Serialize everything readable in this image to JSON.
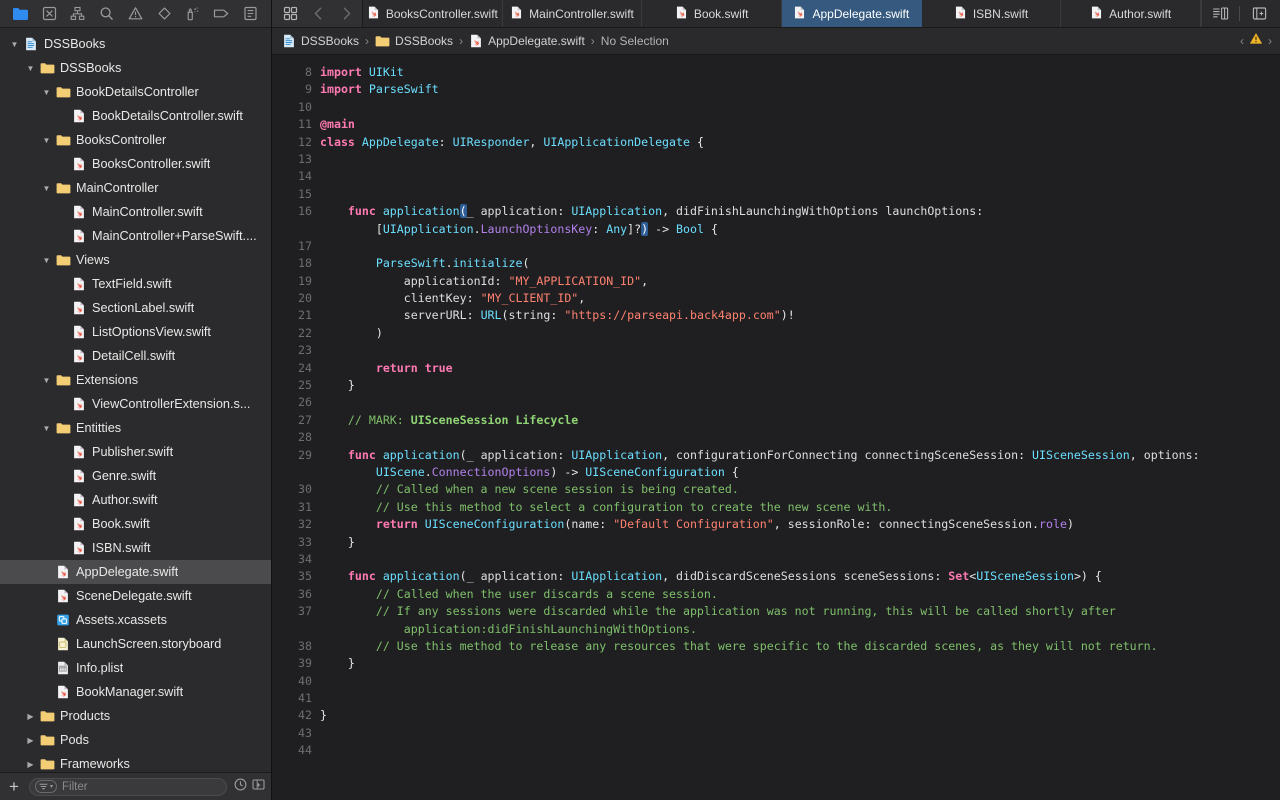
{
  "navigator": {
    "toolbar_icons": [
      {
        "name": "project-navigator-icon",
        "glyph": "folder",
        "active": true
      },
      {
        "name": "source-control-navigator-icon",
        "glyph": "x-box",
        "active": false
      },
      {
        "name": "symbol-navigator-icon",
        "glyph": "hierarchy",
        "active": false
      },
      {
        "name": "find-navigator-icon",
        "glyph": "search",
        "active": false
      },
      {
        "name": "issue-navigator-icon",
        "glyph": "warning-triangle",
        "active": false
      },
      {
        "name": "test-navigator-icon",
        "glyph": "diamond",
        "active": false
      },
      {
        "name": "debug-navigator-icon",
        "glyph": "spray",
        "active": false
      },
      {
        "name": "breakpoint-navigator-icon",
        "glyph": "tag",
        "active": false
      },
      {
        "name": "report-navigator-icon",
        "glyph": "list-box",
        "active": false
      }
    ],
    "tree": [
      {
        "label": "DSSBooks",
        "indent": 0,
        "icon": "project",
        "disclosure": "open",
        "selected": false
      },
      {
        "label": "DSSBooks",
        "indent": 1,
        "icon": "folder",
        "disclosure": "open",
        "selected": false
      },
      {
        "label": "BookDetailsController",
        "indent": 2,
        "icon": "folder",
        "disclosure": "open",
        "selected": false
      },
      {
        "label": "BookDetailsController.swift",
        "indent": 3,
        "icon": "swift",
        "disclosure": "none",
        "selected": false
      },
      {
        "label": "BooksController",
        "indent": 2,
        "icon": "folder",
        "disclosure": "open",
        "selected": false
      },
      {
        "label": "BooksController.swift",
        "indent": 3,
        "icon": "swift",
        "disclosure": "none",
        "selected": false
      },
      {
        "label": "MainController",
        "indent": 2,
        "icon": "folder",
        "disclosure": "open",
        "selected": false
      },
      {
        "label": "MainController.swift",
        "indent": 3,
        "icon": "swift",
        "disclosure": "none",
        "selected": false
      },
      {
        "label": "MainController+ParseSwift....",
        "indent": 3,
        "icon": "swift",
        "disclosure": "none",
        "selected": false
      },
      {
        "label": "Views",
        "indent": 2,
        "icon": "folder",
        "disclosure": "open",
        "selected": false
      },
      {
        "label": "TextField.swift",
        "indent": 3,
        "icon": "swift",
        "disclosure": "none",
        "selected": false
      },
      {
        "label": "SectionLabel.swift",
        "indent": 3,
        "icon": "swift",
        "disclosure": "none",
        "selected": false
      },
      {
        "label": "ListOptionsView.swift",
        "indent": 3,
        "icon": "swift",
        "disclosure": "none",
        "selected": false
      },
      {
        "label": "DetailCell.swift",
        "indent": 3,
        "icon": "swift",
        "disclosure": "none",
        "selected": false
      },
      {
        "label": "Extensions",
        "indent": 2,
        "icon": "folder",
        "disclosure": "open",
        "selected": false
      },
      {
        "label": "ViewControllerExtension.s...",
        "indent": 3,
        "icon": "swift",
        "disclosure": "none",
        "selected": false
      },
      {
        "label": "Entitties",
        "indent": 2,
        "icon": "folder",
        "disclosure": "open",
        "selected": false
      },
      {
        "label": "Publisher.swift",
        "indent": 3,
        "icon": "swift",
        "disclosure": "none",
        "selected": false
      },
      {
        "label": "Genre.swift",
        "indent": 3,
        "icon": "swift",
        "disclosure": "none",
        "selected": false
      },
      {
        "label": "Author.swift",
        "indent": 3,
        "icon": "swift",
        "disclosure": "none",
        "selected": false
      },
      {
        "label": "Book.swift",
        "indent": 3,
        "icon": "swift",
        "disclosure": "none",
        "selected": false
      },
      {
        "label": "ISBN.swift",
        "indent": 3,
        "icon": "swift",
        "disclosure": "none",
        "selected": false
      },
      {
        "label": "AppDelegate.swift",
        "indent": 2,
        "icon": "swift",
        "disclosure": "none",
        "selected": true
      },
      {
        "label": "SceneDelegate.swift",
        "indent": 2,
        "icon": "swift",
        "disclosure": "none",
        "selected": false
      },
      {
        "label": "Assets.xcassets",
        "indent": 2,
        "icon": "assets",
        "disclosure": "none",
        "selected": false
      },
      {
        "label": "LaunchScreen.storyboard",
        "indent": 2,
        "icon": "storyboard",
        "disclosure": "none",
        "selected": false
      },
      {
        "label": "Info.plist",
        "indent": 2,
        "icon": "plist",
        "disclosure": "none",
        "selected": false
      },
      {
        "label": "BookManager.swift",
        "indent": 2,
        "icon": "swift",
        "disclosure": "none",
        "selected": false
      },
      {
        "label": "Products",
        "indent": 1,
        "icon": "folder",
        "disclosure": "closed",
        "selected": false
      },
      {
        "label": "Pods",
        "indent": 1,
        "icon": "folder",
        "disclosure": "closed",
        "selected": false
      },
      {
        "label": "Frameworks",
        "indent": 1,
        "icon": "folder",
        "disclosure": "closed",
        "selected": false
      }
    ],
    "filter": {
      "placeholder": "Filter",
      "add_label": "+",
      "scope_icon": "filter-scope-icon",
      "recent_icon": "clock-icon",
      "nesting_icon": "hierarchy-toggle-icon"
    }
  },
  "tabbar": {
    "left_icons": [
      {
        "name": "editor-options-icon",
        "glyph": "grid"
      },
      {
        "name": "navigate-back-button",
        "glyph": "chevron-left"
      },
      {
        "name": "navigate-forward-button",
        "glyph": "chevron-right"
      }
    ],
    "tabs": [
      {
        "label": "BooksController.swift",
        "active": false
      },
      {
        "label": "MainController.swift",
        "active": false
      },
      {
        "label": "Book.swift",
        "active": false
      },
      {
        "label": "AppDelegate.swift",
        "active": true
      },
      {
        "label": "ISBN.swift",
        "active": false
      },
      {
        "label": "Author.swift",
        "active": false
      }
    ],
    "right_icons": [
      {
        "name": "minimap-toggle-icon",
        "glyph": "minimap"
      },
      {
        "name": "add-editor-icon",
        "glyph": "add-pane"
      }
    ]
  },
  "jumpbar": {
    "crumbs": [
      {
        "label": "DSSBooks",
        "icon": "project"
      },
      {
        "label": "DSSBooks",
        "icon": "folder"
      },
      {
        "label": "AppDelegate.swift",
        "icon": "swift"
      },
      {
        "label": "No Selection",
        "icon": "none"
      }
    ],
    "separator": "›",
    "issue_prev": "‹",
    "issue_next": "›",
    "issue_icon": "warning-triangle-icon"
  },
  "editor": {
    "first_line_number": 8,
    "last_line_number": 44,
    "gutter": [
      {
        "n": "8"
      },
      {
        "n": "9"
      },
      {
        "n": "10"
      },
      {
        "n": "11"
      },
      {
        "n": "12"
      },
      {
        "n": "13"
      },
      {
        "n": "14"
      },
      {
        "n": "15"
      },
      {
        "n": "16"
      },
      {
        "n": ""
      },
      {
        "n": "17"
      },
      {
        "n": "18"
      },
      {
        "n": "19"
      },
      {
        "n": "20"
      },
      {
        "n": "21"
      },
      {
        "n": "22"
      },
      {
        "n": "23"
      },
      {
        "n": "24"
      },
      {
        "n": "25"
      },
      {
        "n": "26"
      },
      {
        "n": "27"
      },
      {
        "n": "28"
      },
      {
        "n": "29"
      },
      {
        "n": ""
      },
      {
        "n": "30"
      },
      {
        "n": "31"
      },
      {
        "n": "32"
      },
      {
        "n": "33"
      },
      {
        "n": "34"
      },
      {
        "n": "35"
      },
      {
        "n": "36"
      },
      {
        "n": "37"
      },
      {
        "n": ""
      },
      {
        "n": "38"
      },
      {
        "n": "39"
      },
      {
        "n": "40"
      },
      {
        "n": "41"
      },
      {
        "n": "42"
      },
      {
        "n": "43"
      },
      {
        "n": "44"
      }
    ],
    "lines": [
      "import UIKit",
      "import ParseSwift",
      "",
      "@main",
      "class AppDelegate: UIResponder, UIApplicationDelegate {",
      "",
      "",
      "",
      "    func application(_ application: UIApplication, didFinishLaunchingWithOptions launchOptions:",
      "        [UIApplication.LaunchOptionsKey: Any]?) -> Bool {",
      "",
      "        ParseSwift.initialize(",
      "            applicationId: \"MY_APPLICATION_ID\",",
      "            clientKey: \"MY_CLIENT_ID\",",
      "            serverURL: URL(string: \"https://parseapi.back4app.com\")!",
      "        )",
      "",
      "        return true",
      "    }",
      "",
      "    // MARK: UISceneSession Lifecycle",
      "",
      "    func application(_ application: UIApplication, configurationForConnecting connectingSceneSession: UISceneSession, options:",
      "        UIScene.ConnectionOptions) -> UISceneConfiguration {",
      "        // Called when a new scene session is being created.",
      "        // Use this method to select a configuration to create the new scene with.",
      "        return UISceneConfiguration(name: \"Default Configuration\", sessionRole: connectingSceneSession.role)",
      "    }",
      "",
      "    func application(_ application: UIApplication, didDiscardSceneSessions sceneSessions: Set<UISceneSession>) {",
      "        // Called when the user discards a scene session.",
      "        // If any sessions were discarded while the application was not running, this will be called shortly after",
      "            application:didFinishLaunchingWithOptions.",
      "        // Use this method to release any resources that were specific to the discarded scenes, as they will not return.",
      "    }",
      "",
      "",
      "}",
      "",
      ""
    ]
  },
  "colors": {
    "background": "#1f1f21",
    "sidebar": "#2b2b2d",
    "toolbar": "#313133",
    "selection": "#4b4b4d",
    "active_tab": "#35597f",
    "keyword": "#ff7ab2",
    "type": "#6bdfff",
    "string": "#ff8170",
    "comment": "#7fbf6b",
    "property": "#b281eb",
    "line_number": "#6e6e72",
    "match_paren": "#2e5d96",
    "swift_file_icon": "#e8604c",
    "folder_icon": "#f3cd73",
    "accent": "#2f8bf0",
    "warning": "#f0b429"
  }
}
